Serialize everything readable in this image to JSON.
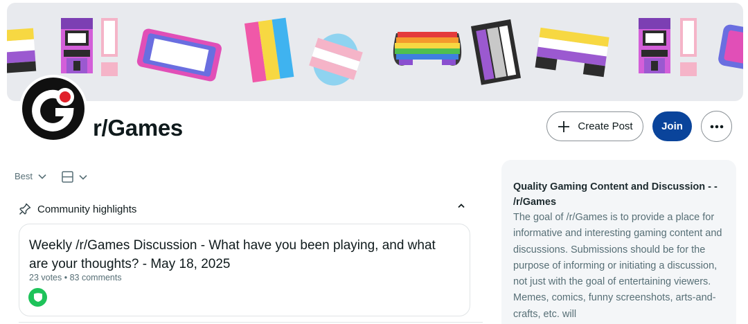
{
  "community": {
    "name": "r/Games",
    "avatar_icon": "games-logo-icon",
    "banner_icons": [
      "arcade-cabinet-icon",
      "exclamation-icon",
      "handheld-console-icon",
      "striped-card-icon",
      "striped-egg-icon",
      "rainbow-gamepad-icon",
      "cartridge-icon",
      "gamepad-icon",
      "arcade-cabinet-icon",
      "exclamation-icon"
    ]
  },
  "actions": {
    "create_post_label": "Create Post",
    "join_label": "Join",
    "more_icon": "ellipsis-icon"
  },
  "feed_controls": {
    "sort_label": "Best",
    "view_icon": "card-view-icon"
  },
  "highlights": {
    "heading": "Community highlights",
    "post": {
      "title": "Weekly /r/Games Discussion - What have you been playing, and what are your thoughts? - May 18, 2025",
      "meta": "23 votes • 83 comments",
      "badge_icon": "mod-shield-icon"
    }
  },
  "sidebar": {
    "title": "Quality Gaming Content and Discussion - - /r/Games",
    "description": "The goal of /r/Games is to provide a place for informative and interesting gaming content and discussions. Submissions should be for the purpose of informing or initiating a discussion, not just with the goal of entertaining viewers. Memes, comics, funny screenshots, arts-and-crafts, etc. will"
  },
  "colors": {
    "join_button": "#0a449b",
    "banner_bg": "#e8eaee",
    "sidebar_bg": "#f4f6f8",
    "badge": "#1ec35a"
  }
}
